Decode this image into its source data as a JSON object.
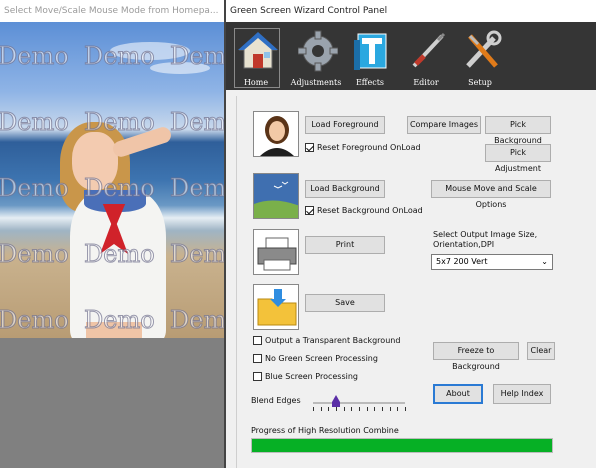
{
  "preview": {
    "title": "Select Move/Scale Mouse Mode from Homepa...",
    "watermark": "Demo"
  },
  "panel": {
    "title": "Green Screen Wizard Control Panel"
  },
  "toolbar": {
    "items": [
      {
        "label": "Home",
        "icon": "house-icon"
      },
      {
        "label": "Adjustments",
        "icon": "gear-icon"
      },
      {
        "label": "Effects",
        "icon": "effects-icon"
      },
      {
        "label": "Editor",
        "icon": "pen-icon"
      },
      {
        "label": "Setup",
        "icon": "tools-icon"
      }
    ]
  },
  "buttons": {
    "load_foreground": "Load Foreground",
    "compare_images": "Compare Images",
    "pick_background": "Pick Background",
    "pick_adjustment": "Pick Adjustment",
    "load_background": "Load Background",
    "mouse_move_scale": "Mouse Move and Scale Options",
    "print": "Print",
    "save": "Save",
    "freeze_to_background": "Freeze to Background",
    "clear": "Clear",
    "about": "About",
    "help_index": "Help Index"
  },
  "checkboxes": {
    "reset_foreground": {
      "label": "Reset Foreground OnLoad",
      "checked": true
    },
    "reset_background": {
      "label": "Reset Background OnLoad",
      "checked": true
    },
    "transparent_bg": {
      "label": "Output a Transparent Background",
      "checked": false
    },
    "no_green_screen": {
      "label": "No Green Screen Processing",
      "checked": false
    },
    "blue_screen": {
      "label": "Blue Screen Processing",
      "checked": false
    }
  },
  "output": {
    "label": "Select Output Image Size, Orientation,DPI",
    "selected": "5x7 200 Vert"
  },
  "blend": {
    "label": "Blend Edges",
    "level": 0.25
  },
  "progress": {
    "label": "Progress of High Resolution Combine",
    "value": 1.0,
    "color": "#06b025"
  }
}
